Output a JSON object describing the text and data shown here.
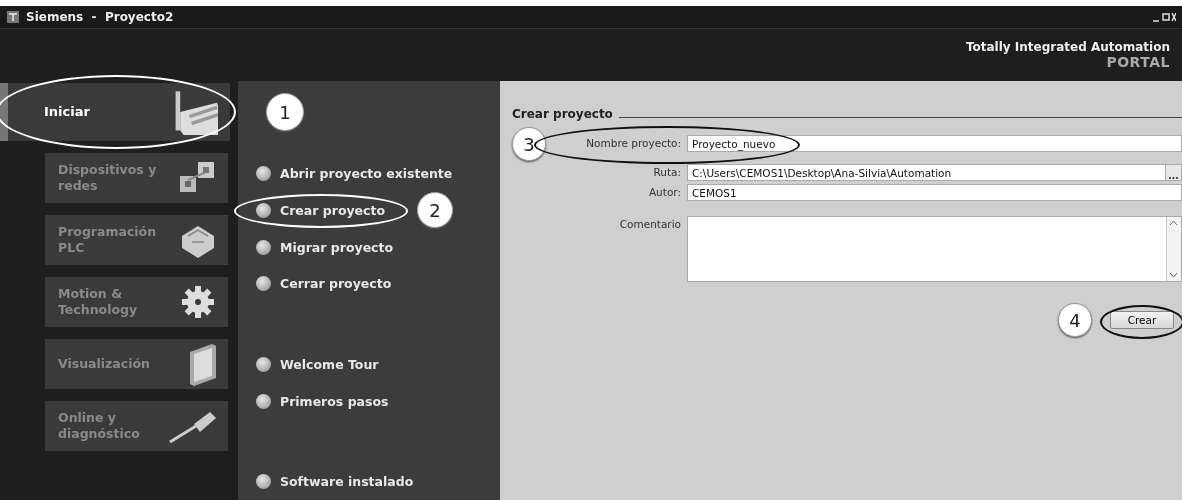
{
  "window": {
    "title": "Siemens  -  Proyecto2"
  },
  "header": {
    "product": "Totally Integrated Automation",
    "portal": "PORTAL"
  },
  "nav": [
    {
      "label": "Iniciar",
      "selected": true,
      "circled": true,
      "step": "1"
    },
    {
      "label": "Dispositivos y\nredes",
      "selected": false
    },
    {
      "label": "Programación\nPLC",
      "selected": false
    },
    {
      "label": "Motion &\nTechnology",
      "selected": false
    },
    {
      "label": "Visualización",
      "selected": false
    },
    {
      "label": "Online y\ndiagnóstico",
      "selected": false
    }
  ],
  "action_groups": [
    {
      "items": [
        {
          "label": "Abrir proyecto existente",
          "circled": false
        },
        {
          "label": "Crear proyecto",
          "circled": true,
          "step": "2"
        },
        {
          "label": "Migrar proyecto",
          "circled": false
        },
        {
          "label": "Cerrar proyecto",
          "circled": false
        }
      ]
    },
    {
      "items": [
        {
          "label": "Welcome Tour",
          "circled": false
        },
        {
          "label": "Primeros pasos",
          "circled": false
        }
      ]
    },
    {
      "items": [
        {
          "label": "Software instalado",
          "circled": false
        }
      ]
    }
  ],
  "form": {
    "title": "Crear proyecto",
    "fields": [
      {
        "kind": "text",
        "label": "Nombre proyecto:",
        "value": "Proyecto_nuevo",
        "circled": true,
        "step": "3"
      },
      {
        "kind": "browse",
        "label": "Ruta:",
        "value": "C:\\Users\\CEMOS1\\Desktop\\Ana-Silvia\\Automation",
        "circled": false
      },
      {
        "kind": "text",
        "label": "Autor:",
        "value": "CEMOS1",
        "circled": false
      },
      {
        "kind": "multiline",
        "label": "Comentario",
        "circled": false
      }
    ],
    "button": {
      "label": "Crear",
      "circled": true,
      "step": "4"
    }
  }
}
